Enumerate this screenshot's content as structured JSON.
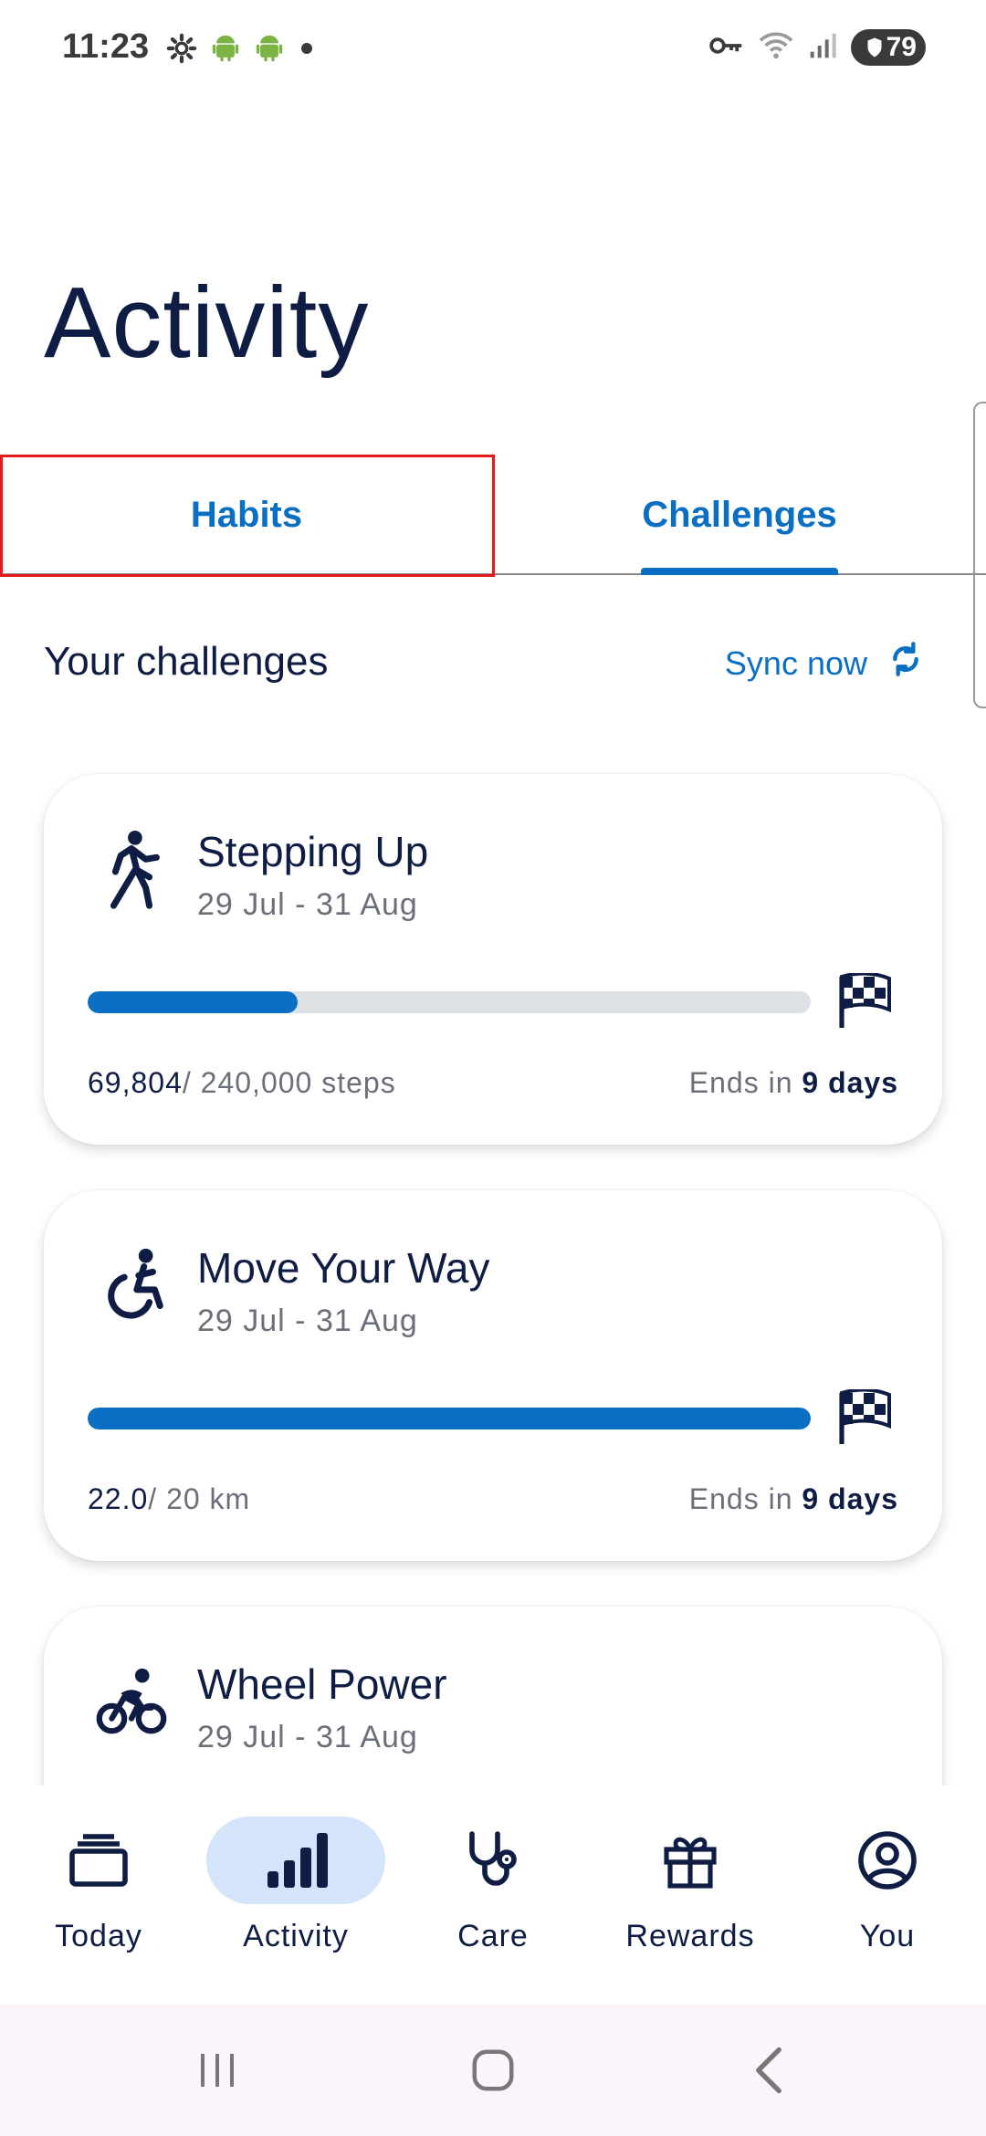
{
  "status_bar": {
    "time": "11:23",
    "battery": "79",
    "icons": [
      "gear-icon",
      "android-icon",
      "android-icon",
      "dot-icon",
      "key-icon",
      "wifi-icon",
      "signal-icon",
      "battery-icon"
    ]
  },
  "page": {
    "title": "Activity"
  },
  "tabs": [
    {
      "label": "Habits",
      "selected": false
    },
    {
      "label": "Challenges",
      "selected": true
    }
  ],
  "section": {
    "title": "Your challenges",
    "sync_label": "Sync now"
  },
  "challenges": [
    {
      "icon": "walking-person-icon",
      "title": "Stepping Up",
      "dates": "29 Jul - 31 Aug",
      "progress_value": "69,804",
      "progress_total": "/ 240,000 steps",
      "progress_fraction": 0.29,
      "ends_prefix": "Ends in",
      "ends_value": "9 days"
    },
    {
      "icon": "wheelchair-icon",
      "title": "Move Your Way",
      "dates": "29 Jul - 31 Aug",
      "progress_value": "22.0",
      "progress_total": "/ 20 km",
      "progress_fraction": 1.0,
      "ends_prefix": "Ends in",
      "ends_value": "9 days"
    },
    {
      "icon": "cyclist-icon",
      "title": "Wheel Power",
      "dates": "29 Jul - 31 Aug"
    }
  ],
  "bottom_nav": [
    {
      "label": "Today",
      "icon": "stacked-cards-icon",
      "active": false
    },
    {
      "label": "Activity",
      "icon": "bar-chart-icon",
      "active": true
    },
    {
      "label": "Care",
      "icon": "stethoscope-icon",
      "active": false
    },
    {
      "label": "Rewards",
      "icon": "gift-icon",
      "active": false
    },
    {
      "label": "You",
      "icon": "person-circle-icon",
      "active": false
    }
  ],
  "system_nav": [
    "recent-apps-icon",
    "home-icon",
    "back-icon"
  ],
  "colors": {
    "accent": "#0a6fc2",
    "text_dark": "#0f1d45",
    "text_muted": "#6b6f79",
    "track": "#dde1e6",
    "active_nav_bg": "#d3e4fb",
    "highlight": "#e11b1b"
  }
}
